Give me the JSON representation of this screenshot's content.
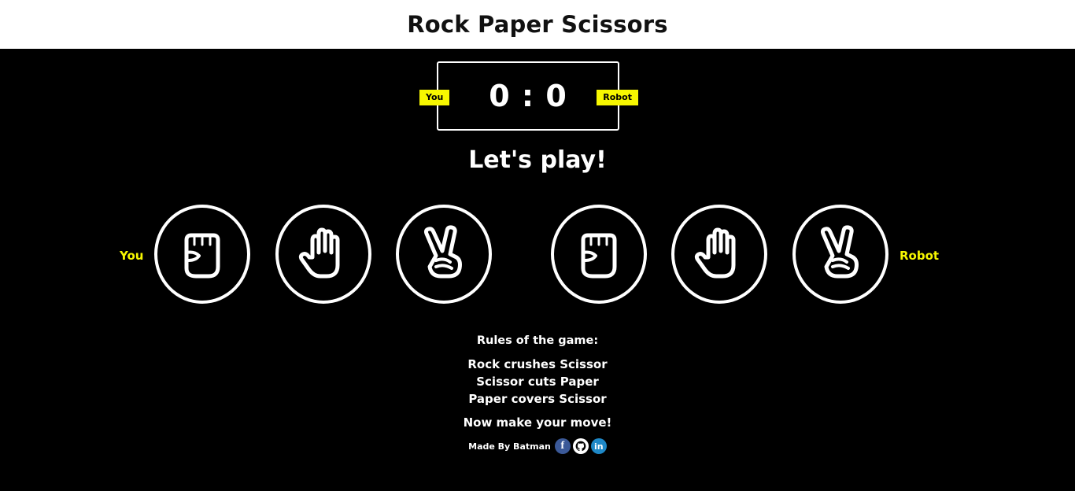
{
  "header": {
    "title": "Rock Paper Scissors"
  },
  "scoreboard": {
    "you_label": "You",
    "robot_label": "Robot",
    "score": "0 : 0"
  },
  "message": "Let's play!",
  "players": {
    "you_label": "You",
    "robot_label": "Robot"
  },
  "choices": {
    "you": [
      {
        "name": "rock",
        "icon": "rock-hand-icon"
      },
      {
        "name": "paper",
        "icon": "paper-hand-icon"
      },
      {
        "name": "scissors",
        "icon": "scissors-hand-icon"
      }
    ],
    "robot": [
      {
        "name": "rock",
        "icon": "rock-hand-icon"
      },
      {
        "name": "paper",
        "icon": "paper-hand-icon"
      },
      {
        "name": "scissors",
        "icon": "scissors-hand-icon"
      }
    ]
  },
  "rules": {
    "heading": "Rules of the game:",
    "lines": [
      "Rock crushes Scissor",
      "Scissor cuts Paper",
      "Paper covers Scissor"
    ],
    "cta": "Now make your move!"
  },
  "footer": {
    "made_by": "Made By Batman",
    "links": [
      {
        "name": "facebook",
        "glyph": "f"
      },
      {
        "name": "github",
        "glyph": "●"
      },
      {
        "name": "linkedin",
        "glyph": "in"
      }
    ]
  },
  "colors": {
    "accent": "#f7f700",
    "background": "#000000",
    "header_bg": "#ffffff"
  }
}
